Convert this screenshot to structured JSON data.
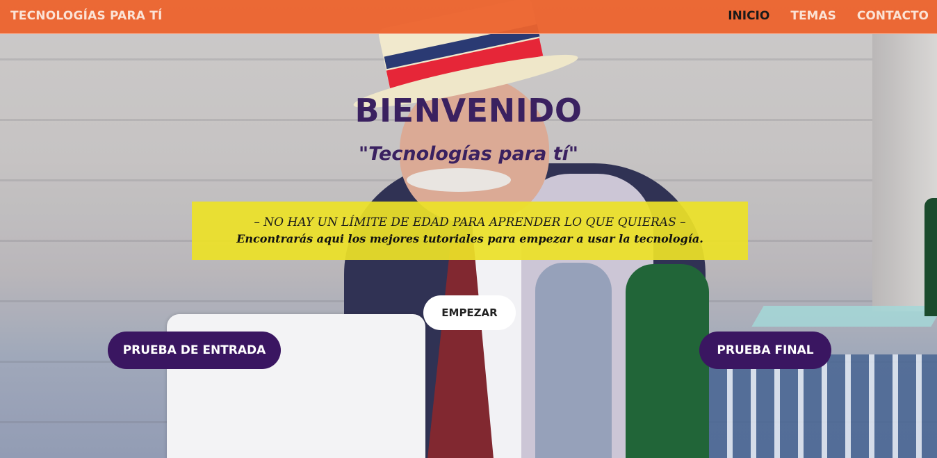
{
  "nav": {
    "brand": "TECNOLOGÍAS PARA TÍ",
    "links": [
      "INICIO",
      "TEMAS",
      "CONTACTO"
    ],
    "active": "INICIO"
  },
  "hero": {
    "title": "BIENVENIDO",
    "subtitle": "\"Tecnologías para tí\"",
    "banner": {
      "line1": "– NO HAY UN LÍMITE DE EDAD PARA APRENDER LO QUE QUIERAS –",
      "line2": "Encontrarás aqui los mejores tutoriales para empezar a usar la tecnología."
    },
    "buttons": {
      "start": "EMPEZAR",
      "entry_test": "PRUEBA DE ENTRADA",
      "final_test": "PRUEBA FINAL"
    }
  },
  "colors": {
    "navbar": "#EC632D",
    "title": "#3A2160",
    "banner": "#ECE128",
    "purple_button": "#3A1661",
    "white_button": "#FFFFFF"
  }
}
